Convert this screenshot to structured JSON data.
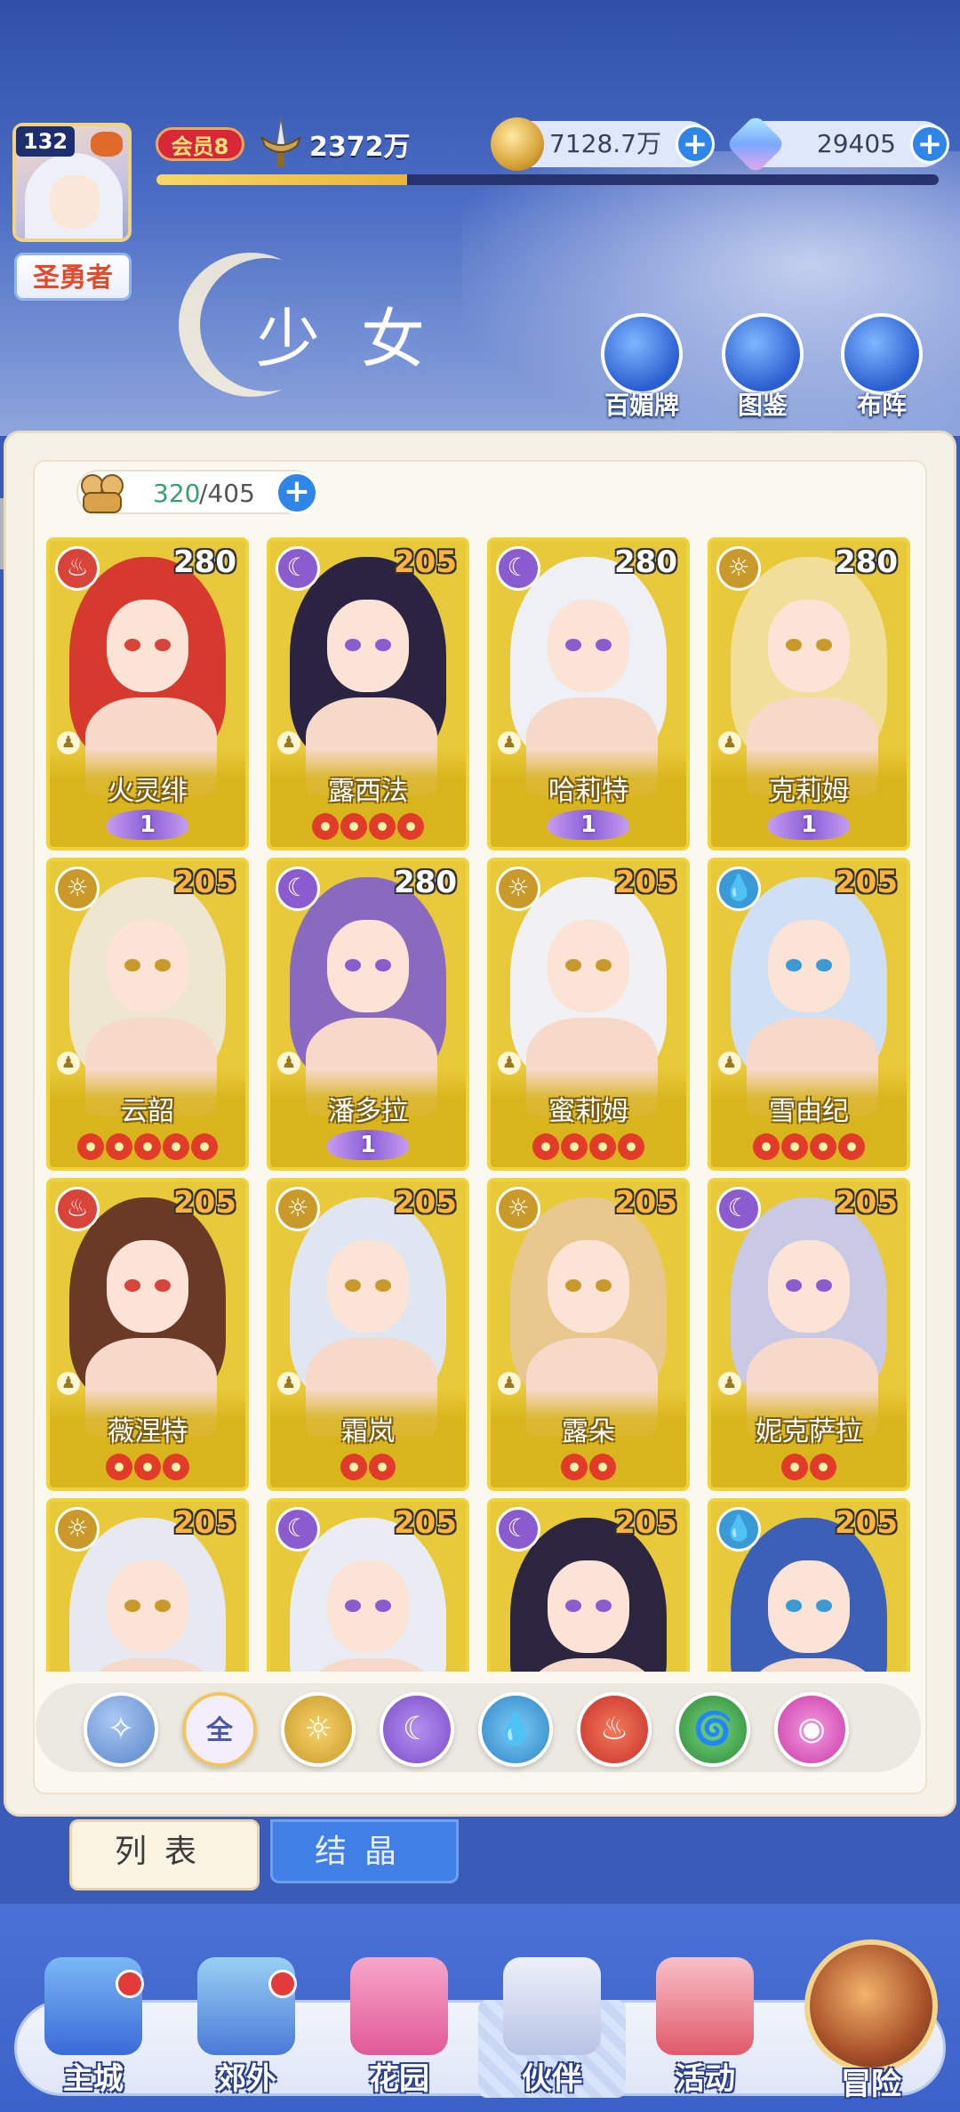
{
  "header": {
    "level": "132",
    "title_badge": "圣勇者",
    "vip": "会员8",
    "power": "2372万",
    "gold": "7128.7万",
    "crystal": "29405",
    "xp_progress": 0.32
  },
  "section_title": "少女",
  "top_buttons": [
    {
      "label": "百媚牌",
      "icon": "card-deck-icon"
    },
    {
      "label": "图鉴",
      "icon": "book-icon"
    },
    {
      "label": "布阵",
      "icon": "grid-formation-icon"
    }
  ],
  "capacity": {
    "current": "320",
    "total": "/405"
  },
  "colors": {
    "fire": "#d8433a",
    "moon": "#8a5cd0",
    "sun": "#c99a2a",
    "water": "#3a9ad6",
    "wind": "#2f9a48",
    "dark": "#d24ab8",
    "all": "#f2eefc"
  },
  "heroes": [
    {
      "name": "火灵绯",
      "level": "280",
      "element": "fire",
      "stars": 0,
      "awaken": "1",
      "hair": "#d63a2e"
    },
    {
      "name": "露西法",
      "level": "205",
      "element": "moon",
      "stars": 4,
      "awaken": "",
      "hair": "#2a2442"
    },
    {
      "name": "哈莉特",
      "level": "280",
      "element": "moon",
      "stars": 0,
      "awaken": "1",
      "hair": "#eef0f6"
    },
    {
      "name": "克莉姆",
      "level": "280",
      "element": "sun",
      "stars": 0,
      "awaken": "1",
      "hair": "#f1de98"
    },
    {
      "name": "云韶",
      "level": "205",
      "element": "sun",
      "stars": 5,
      "awaken": "",
      "hair": "#efe6d2"
    },
    {
      "name": "潘多拉",
      "level": "280",
      "element": "moon",
      "stars": 0,
      "awaken": "1",
      "hair": "#8a6ac0"
    },
    {
      "name": "蜜莉姆",
      "level": "205",
      "element": "sun",
      "stars": 4,
      "awaken": "",
      "hair": "#f1f1f4"
    },
    {
      "name": "雪由纪",
      "level": "205",
      "element": "water",
      "stars": 4,
      "awaken": "",
      "hair": "#cfe0f4"
    },
    {
      "name": "薇涅特",
      "level": "205",
      "element": "fire",
      "stars": 3,
      "awaken": "",
      "hair": "#6a3a26"
    },
    {
      "name": "霜岚",
      "level": "205",
      "element": "sun",
      "stars": 2,
      "awaken": "",
      "hair": "#dfe6f2"
    },
    {
      "name": "露朵",
      "level": "205",
      "element": "sun",
      "stars": 2,
      "awaken": "",
      "hair": "#e8c88c"
    },
    {
      "name": "妮克萨拉",
      "level": "205",
      "element": "moon",
      "stars": 2,
      "awaken": "",
      "hair": "#c9c9e6"
    },
    {
      "name": "",
      "level": "205",
      "element": "sun",
      "stars": 0,
      "awaken": "",
      "hair": "#e6e8f2"
    },
    {
      "name": "",
      "level": "205",
      "element": "moon",
      "stars": 0,
      "awaken": "",
      "hair": "#e9ecf3"
    },
    {
      "name": "",
      "level": "205",
      "element": "moon",
      "stars": 0,
      "awaken": "",
      "hair": "#2c2540"
    },
    {
      "name": "",
      "level": "205",
      "element": "water",
      "stars": 0,
      "awaken": "",
      "hair": "#3c5fb8"
    }
  ],
  "element_filters": [
    {
      "key": "wind-up",
      "label": ""
    },
    {
      "key": "all",
      "label": "全"
    },
    {
      "key": "sun",
      "label": ""
    },
    {
      "key": "moon",
      "label": ""
    },
    {
      "key": "water",
      "label": ""
    },
    {
      "key": "fire",
      "label": ""
    },
    {
      "key": "wind",
      "label": ""
    },
    {
      "key": "dark",
      "label": ""
    }
  ],
  "tabs": {
    "list": "列表",
    "crystal": "结晶"
  },
  "nav": [
    {
      "label": "主城",
      "icon": "castle-icon",
      "badge": true
    },
    {
      "label": "郊外",
      "icon": "portal-icon",
      "badge": true
    },
    {
      "label": "花园",
      "icon": "heart-garden-icon",
      "badge": false
    },
    {
      "label": "伙伴",
      "icon": "partner-icon",
      "badge": false
    },
    {
      "label": "活动",
      "icon": "gift-icon",
      "badge": false
    },
    {
      "label": "冒险",
      "icon": "compass-icon",
      "badge": false
    }
  ]
}
